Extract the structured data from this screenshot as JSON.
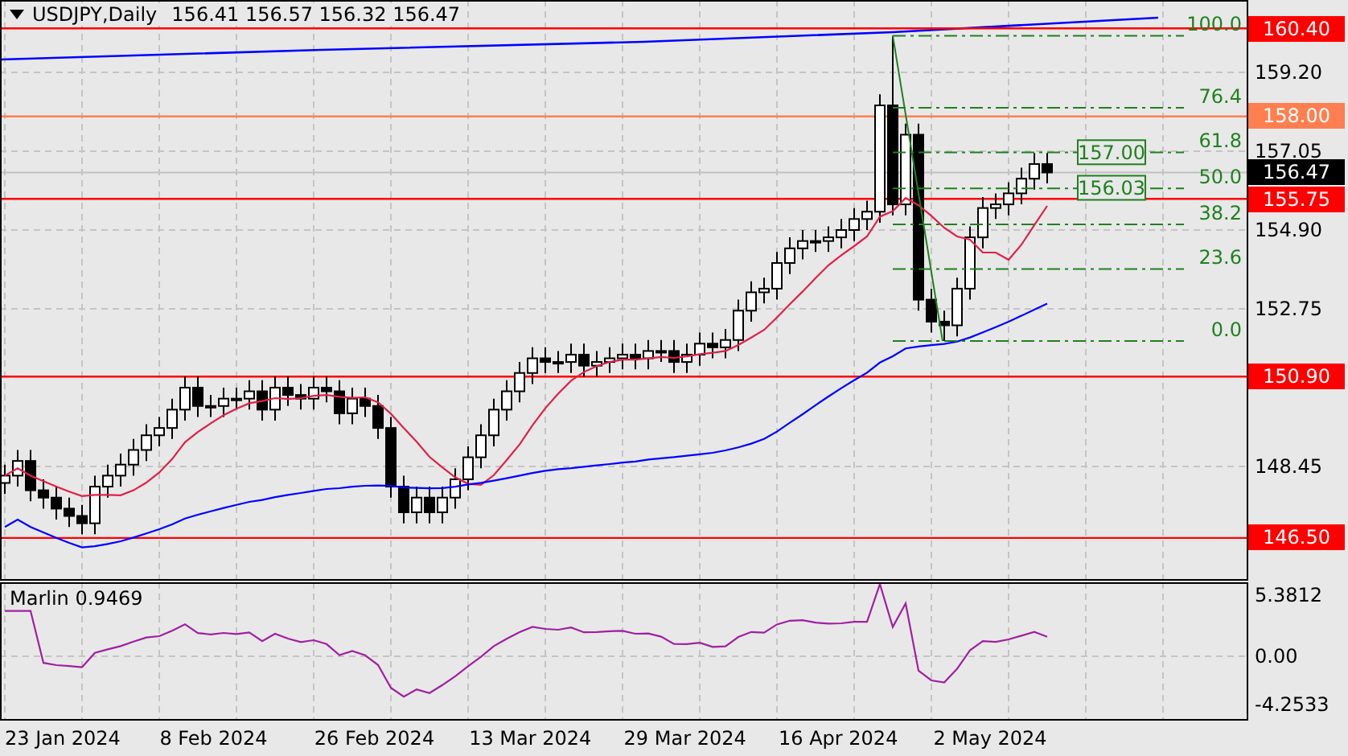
{
  "header": {
    "symbol": "USDJPY,Daily",
    "ohlc": "156.41 156.57 156.32 156.47"
  },
  "price_axis": {
    "ticks": [
      "159.20",
      "157.05",
      "154.90",
      "152.75",
      "148.45"
    ]
  },
  "levels": [
    {
      "label": "160.40",
      "color": "#ff0000",
      "kind": "line"
    },
    {
      "label": "158.00",
      "color": "#ff7f50",
      "kind": "line"
    },
    {
      "label": "156.47",
      "color": "#000000",
      "kind": "current"
    },
    {
      "label": "155.75",
      "color": "#ff0000",
      "kind": "line"
    },
    {
      "label": "150.90",
      "color": "#ff0000",
      "kind": "line"
    },
    {
      "label": "146.50",
      "color": "#ff0000",
      "kind": "line"
    }
  ],
  "fibonacci": {
    "levels": [
      "100.0",
      "76.4",
      "61.8",
      "50.0",
      "38.2",
      "23.6",
      "0.0"
    ]
  },
  "price_boxes": [
    "157.00",
    "156.03"
  ],
  "indicator": {
    "label": "Marlin 0.9469",
    "ticks": [
      "5.3812",
      "0.00",
      "-4.2533"
    ]
  },
  "time_axis": {
    "labels": [
      "23 Jan 2024",
      "8 Feb 2024",
      "26 Feb 2024",
      "13 Mar 2024",
      "29 Mar 2024",
      "16 Apr 2024",
      "2 May 2024"
    ]
  }
}
